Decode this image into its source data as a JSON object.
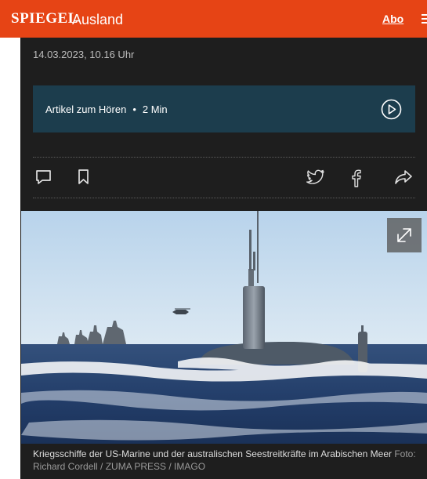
{
  "header": {
    "logo": "SPIEGEL",
    "section": "Ausland",
    "abo_label": "Abo"
  },
  "article": {
    "date": "14.03.2023, 10.16 Uhr",
    "audio": {
      "label": "Artikel zum Hören",
      "separator": "•",
      "duration": "2 Min"
    },
    "caption": {
      "text": "Kriegsschiffe der US-Marine und der australischen Seestreitkräfte im Arabischen Meer",
      "credit": "Foto: Richard Cordell / ZUMA PRESS / IMAGO"
    }
  },
  "icons": {
    "comment": "comment-icon",
    "bookmark": "bookmark-icon",
    "twitter": "twitter-icon",
    "facebook": "facebook-icon",
    "share": "share-icon",
    "play": "play-icon",
    "expand": "expand-icon",
    "menu": "menu-icon"
  },
  "colors": {
    "brand": "#e64415",
    "audio_bg": "#1c3d4d",
    "content_bg": "#1e1e1e"
  }
}
